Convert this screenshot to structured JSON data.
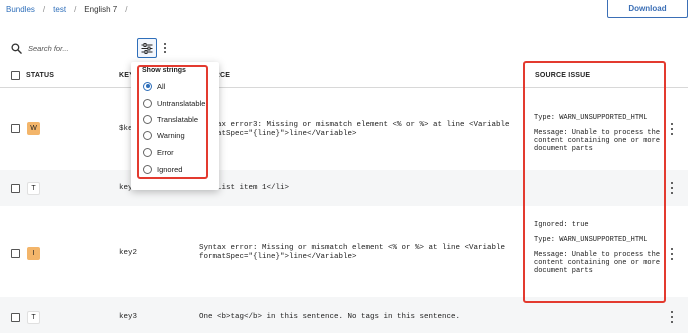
{
  "breadcrumb": {
    "items": [
      "Bundles",
      "test",
      "English 7"
    ],
    "separator": "/"
  },
  "toolbar": {
    "download_label": "Download",
    "search_placeholder": "Search for...",
    "search_value": ""
  },
  "table": {
    "headers": {
      "status": "STATUS",
      "key": "KEY",
      "source": "SOURCE",
      "source_issue": "SOURCE ISSUE"
    },
    "rows": [
      {
        "status": "W",
        "status_type": "warning",
        "key": "$key",
        "source_line1": "Syntax error3: Missing or mismatch element <% or %> at line <Variable",
        "source_line2": "formatSpec=\"{line}\">line</Variable>",
        "issue_lines": [
          "Type: WARN_UNSUPPORTED_HTML",
          "",
          "Message: Unable to process the",
          "content containing one or more",
          "document parts"
        ]
      },
      {
        "status": "T",
        "status_type": "translatable",
        "key": "key1",
        "source_line1": "<li>List item 1</li>",
        "source_line2": "",
        "issue_lines": []
      },
      {
        "status": "I",
        "status_type": "ignored",
        "key": "key2",
        "source_line1": "Syntax error: Missing or mismatch element <% or %> at line <Variable",
        "source_line2": "formatSpec=\"{line}\">line</Variable>",
        "issue_lines": [
          "Ignored: true",
          "",
          "Type: WARN_UNSUPPORTED_HTML",
          "",
          "Message: Unable to process the",
          "content containing one or more",
          "document parts"
        ]
      },
      {
        "status": "T",
        "status_type": "translatable",
        "key": "key3",
        "source_line1": "One <b>tag</b> in this sentence. No tags in this sentence.",
        "source_line2": "",
        "issue_lines": []
      }
    ]
  },
  "show_strings": {
    "title": "Show strings",
    "options": [
      "All",
      "Untranslatable",
      "Translatable",
      "Warning",
      "Error",
      "Ignored"
    ],
    "selected": "All"
  },
  "colors": {
    "accent": "#2f6fba",
    "warning_badge": "#f3b56a",
    "annotation": "#e33a2f"
  }
}
